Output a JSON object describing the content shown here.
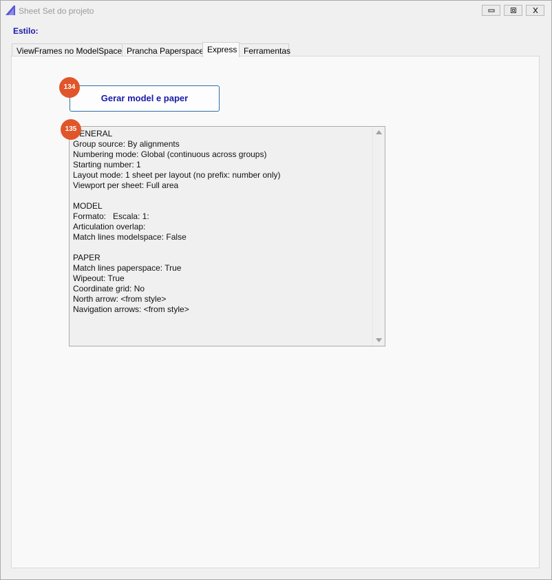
{
  "window": {
    "title": "Sheet Set do projeto",
    "brand_color": "#5b57d6"
  },
  "style_label": "Estilo:",
  "tabs": [
    {
      "label": "ViewFrames no ModelSpace",
      "active": false
    },
    {
      "label": "Prancha Paperspace",
      "active": false
    },
    {
      "label": "Express",
      "active": true
    },
    {
      "label": "Ferramentas",
      "active": false
    }
  ],
  "express": {
    "generate_button_label": "Gerar model e paper",
    "summary_text": "GENERAL\nGroup source: By alignments\nNumbering mode: Global (continuous across groups)\nStarting number: 1\nLayout mode: 1 sheet per layout (no prefix: number only)\nViewport per sheet: Full area\n\nMODEL\nFormato:   Escala: 1:\nArticulation overlap:\nMatch lines modelspace: False\n\nPAPER\nMatch lines paperspace: True\nWipeout: True\nCoordinate grid: No\nNorth arrow: <from style>\nNavigation arrows: <from style>"
  },
  "badges": {
    "button_badge": "134",
    "summary_badge": "135",
    "color": "#e0562a"
  },
  "icons": {
    "app": "app-logo-icon",
    "minimize": "minimize-icon",
    "maximize": "maximize-icon",
    "close": "close-icon",
    "scroll_up": "scroll-up-arrow-icon",
    "scroll_down": "scroll-down-arrow-icon"
  }
}
